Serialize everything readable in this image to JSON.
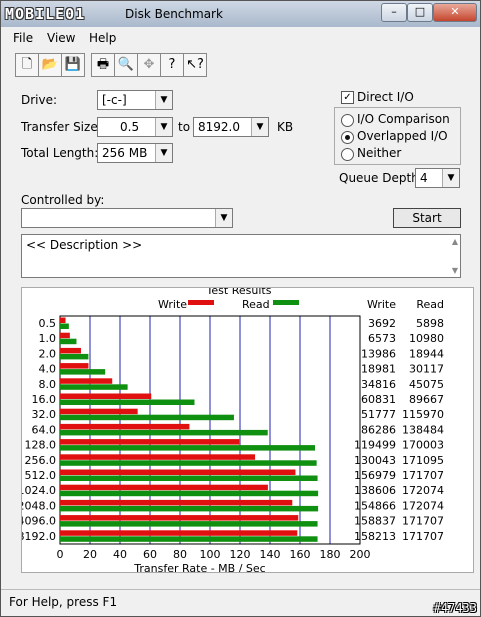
{
  "window": {
    "logo_text": "MOBILE01",
    "title": "Disk Benchmark",
    "controls": {
      "minimize": "–",
      "maximize": "□",
      "close": "✕"
    }
  },
  "menu": [
    "File",
    "View",
    "Help"
  ],
  "toolbar_icons": [
    "new-icon",
    "open-icon",
    "save-icon",
    "print-icon",
    "print-preview-icon",
    "move-icon",
    "help-icon",
    "context-help-icon"
  ],
  "form": {
    "drive_label": "Drive:",
    "drive_value": "[-c-]",
    "transfer_size_label": "Transfer Size:",
    "transfer_from": "0.5",
    "to_label": "to",
    "transfer_to": "8192.0",
    "kb_label": "KB",
    "total_length_label": "Total Length:",
    "total_length_value": "256 MB",
    "controlled_by_label": "Controlled by:",
    "controlled_by_value": "",
    "description": "<< Description >>",
    "direct_io_label": "Direct I/O",
    "direct_io_checked": true,
    "radio_options": [
      "I/O Comparison",
      "Overlapped I/O",
      "Neither"
    ],
    "radio_selected": "Overlapped I/O",
    "queue_depth_label": "Queue Depth:",
    "queue_depth_value": "4",
    "start_label": "Start"
  },
  "results": {
    "title": "Test Results",
    "write_col": "Write",
    "read_col": "Read",
    "write_color": "#e01010",
    "read_color": "#109010"
  },
  "chart_data": {
    "type": "bar",
    "orientation": "horizontal",
    "categories": [
      "0.5",
      "1.0",
      "2.0",
      "4.0",
      "8.0",
      "16.0",
      "32.0",
      "64.0",
      "128.0",
      "256.0",
      "512.0",
      "1024.0",
      "2048.0",
      "4096.0",
      "8192.0"
    ],
    "series": [
      {
        "name": "Write",
        "values": [
          3692,
          6573,
          13986,
          18981,
          34816,
          60831,
          51777,
          86286,
          119499,
          130043,
          156979,
          138606,
          154866,
          158837,
          158213
        ]
      },
      {
        "name": "Read",
        "values": [
          5898,
          10980,
          18944,
          30117,
          45075,
          89667,
          115970,
          138484,
          170003,
          171095,
          171707,
          172074,
          172074,
          171707,
          171707
        ]
      }
    ],
    "xlabel": "Transfer Rate - MB / Sec",
    "xlim": [
      0,
      200
    ],
    "xticks": [
      "0",
      "20",
      "40",
      "60",
      "80",
      "100",
      "120",
      "140",
      "160",
      "180",
      "200"
    ],
    "legend": "top"
  },
  "status_text": "For Help, press F1",
  "watermark": "#47433"
}
